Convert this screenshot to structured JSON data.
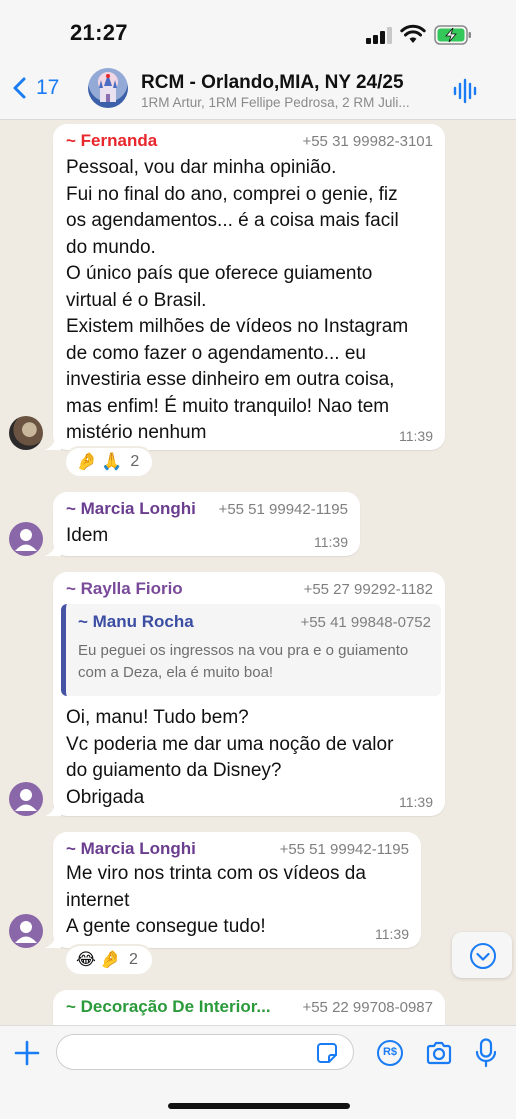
{
  "status_bar": {
    "time": "21:27"
  },
  "header": {
    "back_count": "17",
    "group_name": "RCM - Orlando,MIA, NY 24/25",
    "group_subtitle": "1RM Artur, 1RM Fellipe Pedrosa, 2 RM Juli..."
  },
  "messages": [
    {
      "sender": "~ Fernanda",
      "sender_color": "#e8272c",
      "phone": "+55 31 99982-3101",
      "lines": [
        "Pessoal, vou dar minha opinião.",
        "Fui no final do ano, comprei o genie, fiz",
        "os agendamentos... é a coisa mais facil",
        "do mundo.",
        "O único país que oferece guiamento",
        "virtual é o Brasil.",
        "Existem milhões de vídeos no Instagram",
        "de como fazer o agendamento... eu",
        "investiria esse dinheiro em outra coisa,",
        "mas enfim! É muito tranquilo! Nao tem",
        "mistério nenhum"
      ],
      "time": "11:39",
      "reactions": {
        "emojis": [
          "🤌",
          "🙏"
        ],
        "count": "2"
      }
    },
    {
      "sender": "~ Marcia Longhi",
      "sender_color": "#6a3d8f",
      "phone": "+55 51 99942-1195",
      "lines": [
        "Idem"
      ],
      "time": "11:39"
    },
    {
      "sender": "~ Raylla Fiorio",
      "sender_color": "#7a4a9a",
      "phone": "+55 27 99292-1182",
      "quote": {
        "sender": "~ Manu Rocha",
        "phone": "+55 41 99848-0752",
        "lines": [
          "Eu peguei os ingressos na vou pra e o guiamento",
          "com a Deza, ela é muito boa!"
        ]
      },
      "lines": [
        "Oi, manu! Tudo bem?",
        "Vc poderia me dar uma noção de valor",
        "do guiamento da Disney?",
        "Obrigada"
      ],
      "time": "11:39"
    },
    {
      "sender": "~ Marcia Longhi",
      "sender_color": "#6a3d8f",
      "phone": "+55 51 99942-1195",
      "lines": [
        "Me viro nos trinta com os vídeos da",
        "internet",
        "A gente consegue tudo!"
      ],
      "time": "11:39",
      "reactions": {
        "emojis": [
          "😂",
          "🤌"
        ],
        "count": "2"
      }
    },
    {
      "sender": "~ Decoração De Interior...",
      "sender_color": "#2a9a3a",
      "phone": "+55 22 99708-0987"
    }
  ],
  "input": {
    "placeholder": ""
  },
  "icons": {
    "back": "chevron-left-icon",
    "audio": "waveform-icon",
    "scroll": "chevron-down-circle-icon",
    "attach": "plus-icon",
    "sticker": "sticker-icon",
    "pix": "pix-icon",
    "camera": "camera-icon",
    "mic": "microphone-icon"
  },
  "pix_label": "R$",
  "accent_color": "#1a7cf4"
}
